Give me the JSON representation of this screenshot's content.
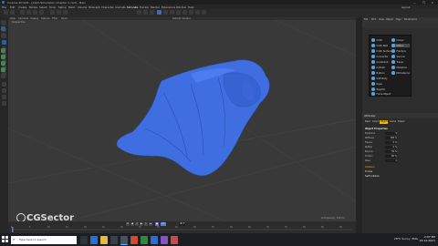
{
  "app": {
    "title": "Cinema 4D R25 - [Cloth Simulation Chapter 1.c4d] - Main",
    "window_controls": "— ❐ ✕"
  },
  "menu": [
    "File",
    "Edit",
    "Create",
    "Modes",
    "Select",
    "Tools",
    "Spline",
    "Mesh",
    "Volume",
    "MoGraph",
    "Character",
    "Animate",
    "Simulate",
    "Tracker",
    "Render",
    "Extensions",
    "Window",
    "Help",
    "Layout"
  ],
  "viewport": {
    "tabs": [
      "View",
      "Cameras",
      "Display",
      "Options",
      "Filter",
      "Panel"
    ],
    "camera_label": "Default Camera",
    "grid_spacing": "Grid Spacing : 100 cm",
    "perspective": "Perspective"
  },
  "watermark": {
    "text": "CGSector"
  },
  "object_manager": {
    "tabs": [
      "File",
      "Edit",
      "View",
      "Object",
      "Tags",
      "Bookmarks"
    ]
  },
  "popup_menu": {
    "left_items": [
      "Cloth",
      "Cloth Belt",
      "Cloth Surface",
      "Connector",
      "Constraint",
      "Collider",
      "Balloon",
      "Soft Body",
      "Rope",
      "Ragdoll",
      "Force Object"
    ],
    "right_items": [
      "Cloner",
      "Matrix",
      "Fracture",
      "Voronoi",
      "Tracer",
      "MoSpline",
      "MoInstance"
    ],
    "highlighted": "Matrix"
  },
  "attributes": {
    "header": "Attributes",
    "tabs": [
      "Basic",
      "Coord",
      "Object",
      "Cache",
      "Expert"
    ],
    "active_tab": "Object",
    "section": "Object Properties",
    "rows": [
      {
        "label": "Iterations",
        "value": "5"
      },
      {
        "label": "Stiffness",
        "value": "100 %"
      },
      {
        "label": "Flexion",
        "value": "0 %"
      },
      {
        "label": "Rubber",
        "value": "0 %"
      },
      {
        "label": "Bounce",
        "value": "50 %"
      },
      {
        "label": "Friction",
        "value": "80 %"
      },
      {
        "label": "Mass",
        "value": "1"
      }
    ],
    "subsections": [
      "Collision",
      "Forces",
      "Self Collision"
    ]
  },
  "timeline": {
    "ticks": [
      "0",
      "5",
      "10",
      "15",
      "20",
      "25",
      "30",
      "35",
      "40",
      "45",
      "50",
      "55",
      "60",
      "65",
      "70",
      "75",
      "80",
      "85",
      "90"
    ],
    "current_frame": "0 F",
    "end_frame": "90 F"
  },
  "taskbar": {
    "search_placeholder": "Type here to search",
    "weather": "28°C  Sunny",
    "lang": "ENG",
    "time": "2:07 PM",
    "date": "23-12-2021"
  },
  "colors": {
    "cloth": "#3f6ee0",
    "accent": "#f5b800",
    "viewport_bg": "#393939"
  }
}
